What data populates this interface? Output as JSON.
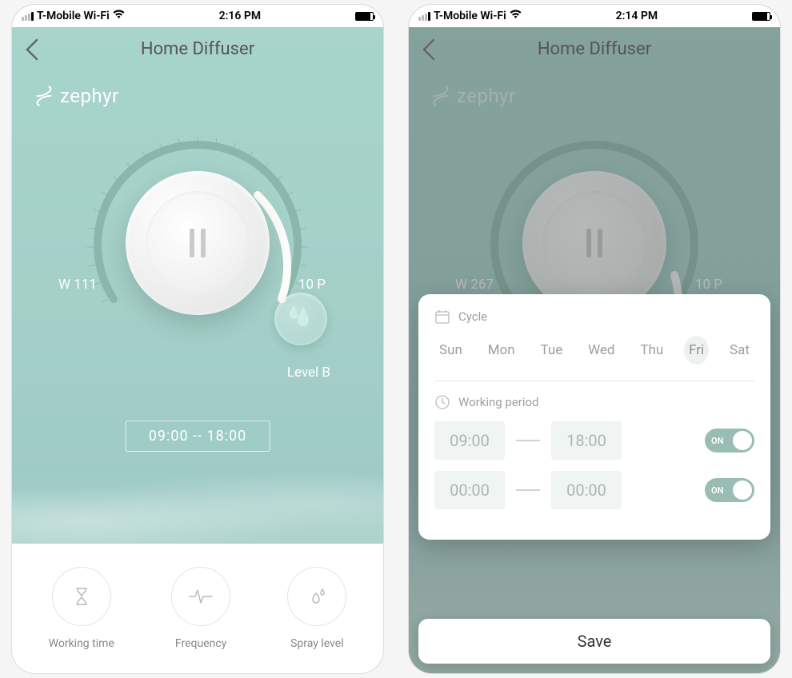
{
  "screen_a": {
    "status": {
      "carrier": "T-Mobile Wi-Fi",
      "time": "2:16 PM"
    },
    "header_title": "Home Diffuser",
    "brand": "zephyr",
    "dial": {
      "left": "W 111",
      "right": "10 P",
      "level": "Level B"
    },
    "time_chip": "09:00 -- 18:00",
    "bottom": {
      "working_time": "Working time",
      "frequency": "Frequency",
      "spray_level": "Spray level"
    }
  },
  "screen_b": {
    "status": {
      "carrier": "T-Mobile Wi-Fi",
      "time": "2:14 PM"
    },
    "header_title": "Home Diffuser",
    "brand": "zephyr",
    "dial": {
      "left": "W 267",
      "right": "10 P"
    },
    "sheet": {
      "cycle_label": "Cycle",
      "days": [
        "Sun",
        "Mon",
        "Tue",
        "Wed",
        "Thu",
        "Fri",
        "Sat"
      ],
      "selected_day_index": 5,
      "working_period_label": "Working period",
      "period1": {
        "from": "09:00",
        "to": "18:00",
        "toggle": "ON"
      },
      "period2": {
        "from": "00:00",
        "to": "00:00",
        "toggle": "ON"
      }
    },
    "save_label": "Save"
  }
}
